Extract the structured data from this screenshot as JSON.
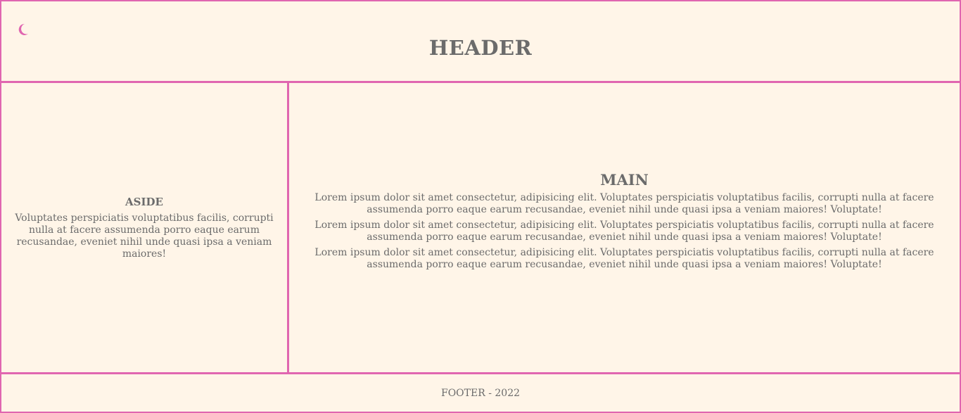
{
  "theme": {
    "accent": "#e066b0",
    "background": "#fff5e8",
    "text": "#6b6b6b"
  },
  "header": {
    "title": "HEADER",
    "theme_toggle_icon": "moon-icon"
  },
  "aside": {
    "title": "ASIDE",
    "text": "Voluptates perspiciatis voluptatibus facilis, corrupti nulla at facere assumenda porro eaque earum recusandae, eveniet nihil unde quasi ipsa a veniam maiores!"
  },
  "main": {
    "title": "MAIN",
    "paragraphs": [
      "Lorem ipsum dolor sit amet consectetur, adipisicing elit. Voluptates perspiciatis voluptatibus facilis, corrupti nulla at facere assumenda porro eaque earum recusandae, eveniet nihil unde quasi ipsa a veniam maiores! Voluptate!",
      "Lorem ipsum dolor sit amet consectetur, adipisicing elit. Voluptates perspiciatis voluptatibus facilis, corrupti nulla at facere assumenda porro eaque earum recusandae, eveniet nihil unde quasi ipsa a veniam maiores! Voluptate!",
      "Lorem ipsum dolor sit amet consectetur, adipisicing elit. Voluptates perspiciatis voluptatibus facilis, corrupti nulla at facere assumenda porro eaque earum recusandae, eveniet nihil unde quasi ipsa a veniam maiores! Voluptate!"
    ]
  },
  "footer": {
    "text": "FOOTER - 2022"
  }
}
